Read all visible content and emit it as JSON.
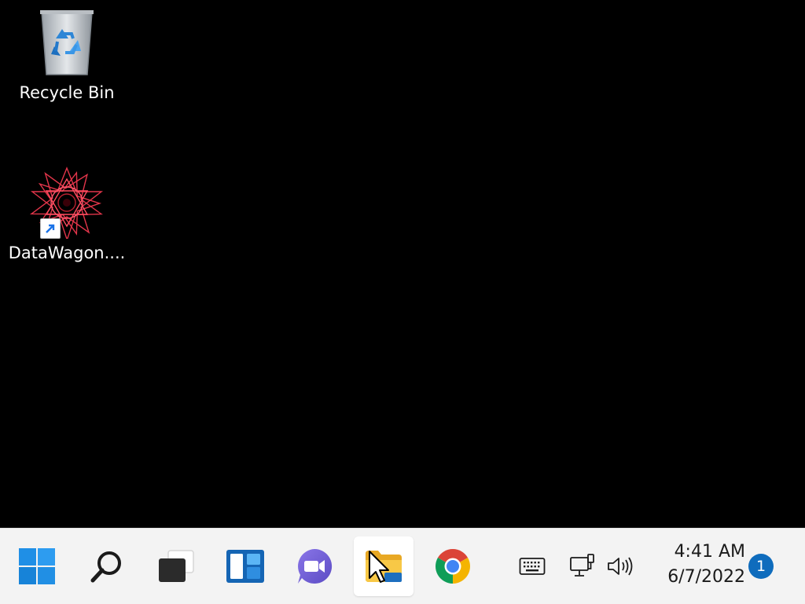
{
  "desktop": {
    "background": "#000000",
    "icons": [
      {
        "label": "Recycle Bin",
        "icon": "recycle-bin-icon"
      },
      {
        "label": "DataWagon....",
        "icon": "datawagon-app-icon",
        "shortcut": true
      }
    ]
  },
  "taskbar": {
    "background": "#f3f3f3",
    "apps": [
      {
        "name": "Start",
        "icon": "windows-start-icon"
      },
      {
        "name": "Search",
        "icon": "search-icon"
      },
      {
        "name": "Task View",
        "icon": "task-view-icon"
      },
      {
        "name": "Widgets",
        "icon": "widgets-icon"
      },
      {
        "name": "Chat",
        "icon": "teams-chat-icon"
      },
      {
        "name": "File Explorer",
        "icon": "file-explorer-icon",
        "active": true
      },
      {
        "name": "Google Chrome",
        "icon": "chrome-icon"
      }
    ],
    "tray": {
      "icons": [
        "touch-keyboard-icon",
        "network-icon",
        "volume-icon"
      ],
      "time": "4:41 AM",
      "date": "6/7/2022",
      "notification_count": "1"
    }
  },
  "colors": {
    "accent": "#0f6cbd",
    "folder_yellow": "#f8c846"
  }
}
